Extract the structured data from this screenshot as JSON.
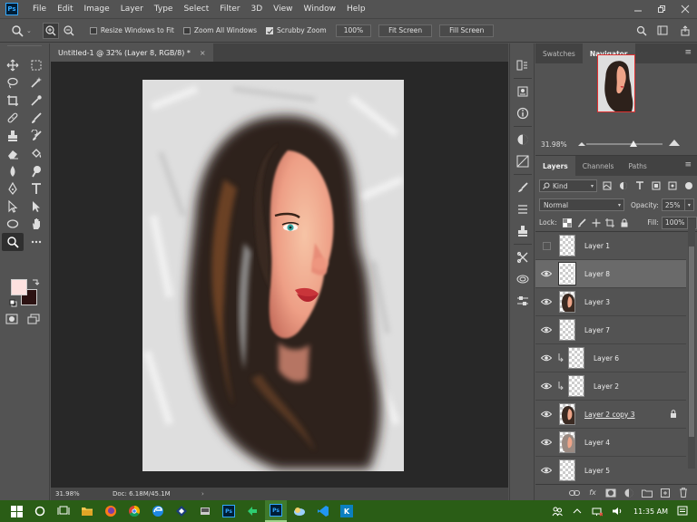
{
  "app": {
    "logo_text": "Ps",
    "menu": [
      "File",
      "Edit",
      "Image",
      "Layer",
      "Type",
      "Select",
      "Filter",
      "3D",
      "View",
      "Window",
      "Help"
    ]
  },
  "options": {
    "resize_windows_label": "Resize Windows to Fit",
    "resize_windows_checked": false,
    "zoom_all_label": "Zoom All Windows",
    "zoom_all_checked": false,
    "scrubby_zoom_label": "Scrubby Zoom",
    "scrubby_zoom_checked": true,
    "zoom_value": "100%",
    "fit_screen_label": "Fit Screen",
    "fill_screen_label": "Fill Screen"
  },
  "document": {
    "tab_title": "Untitled-1 @ 32% (Layer 8, RGB/8) *",
    "close_glyph": "×"
  },
  "status": {
    "zoom": "31.98%",
    "doc_size": "Doc: 6.18M/45.1M",
    "arrow": "›"
  },
  "colors": {
    "foreground": "#fde1df",
    "background": "#2c1212"
  },
  "panels": {
    "top_tabs": [
      "Swatches",
      "Navigator"
    ],
    "top_active": "Navigator",
    "navigator_zoom": "31.98%",
    "layer_tabs": [
      "Layers",
      "Channels",
      "Paths"
    ],
    "layer_active": "Layers",
    "filter_kind": "Kind",
    "blend_mode": "Normal",
    "opacity_label": "Opacity:",
    "opacity_value": "25%",
    "lock_label": "Lock:",
    "fill_label": "Fill:",
    "fill_value": "100%"
  },
  "layers": [
    {
      "name": "Layer 1",
      "visible": false,
      "selected": false,
      "clipped": false,
      "thumb": "empty",
      "locked": false
    },
    {
      "name": "Layer 8",
      "visible": true,
      "selected": true,
      "clipped": false,
      "thumb": "empty",
      "locked": false
    },
    {
      "name": "Layer 3",
      "visible": true,
      "selected": false,
      "clipped": false,
      "thumb": "face",
      "locked": false
    },
    {
      "name": "Layer 7",
      "visible": true,
      "selected": false,
      "clipped": false,
      "thumb": "empty",
      "locked": false
    },
    {
      "name": "Layer 6",
      "visible": true,
      "selected": false,
      "clipped": true,
      "thumb": "empty",
      "locked": false
    },
    {
      "name": "Layer 2",
      "visible": true,
      "selected": false,
      "clipped": true,
      "thumb": "empty",
      "locked": false
    },
    {
      "name": "Layer 2 copy 3",
      "visible": true,
      "selected": false,
      "clipped": false,
      "thumb": "face",
      "locked": true
    },
    {
      "name": "Layer 4",
      "visible": true,
      "selected": false,
      "clipped": false,
      "thumb": "face-light",
      "locked": false
    },
    {
      "name": "Layer 5",
      "visible": true,
      "selected": false,
      "clipped": false,
      "thumb": "empty",
      "locked": false
    }
  ],
  "taskbar": {
    "clock": "11:35 AM",
    "ps_tile_text": "Ps",
    "vs_tile_text": "K"
  }
}
